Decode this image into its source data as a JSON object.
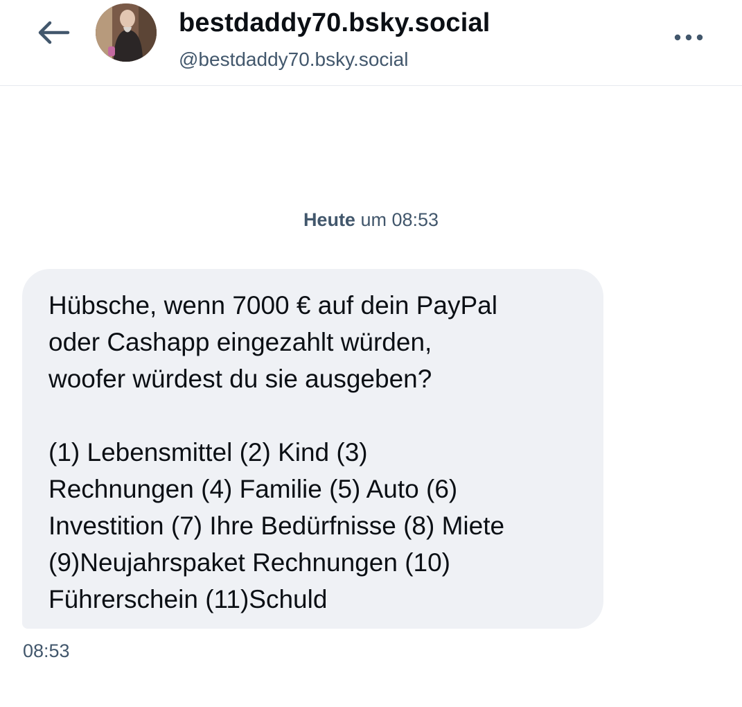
{
  "header": {
    "back_icon": "arrow-left-icon",
    "display_name": "bestdaddy70.bsky.social",
    "handle": "@bestdaddy70.bsky.social",
    "more_icon": "more-horizontal-icon"
  },
  "conversation": {
    "date_separator": {
      "day": "Heute",
      "time": "um 08:53"
    },
    "message": {
      "lines": [
        "Hübsche, wenn 7000 € auf dein PayPal",
        "oder Cashapp eingezahlt würden,",
        "woofer würdest du sie ausgeben?",
        "",
        "(1) Lebensmittel (2) Kind (3)",
        "Rechnungen (4) Familie (5) Auto (6)",
        "Investition (7) Ihre Bedürfnisse (8) Miete",
        "(9)Neujahrspaket Rechnungen (10)",
        "Führerschein (11)Schuld"
      ],
      "timestamp": "08:53"
    }
  },
  "colors": {
    "accent": "#42576c",
    "bubble_bg": "#eff1f5",
    "text": "#0b0f14",
    "divider": "#e6e9ee"
  }
}
